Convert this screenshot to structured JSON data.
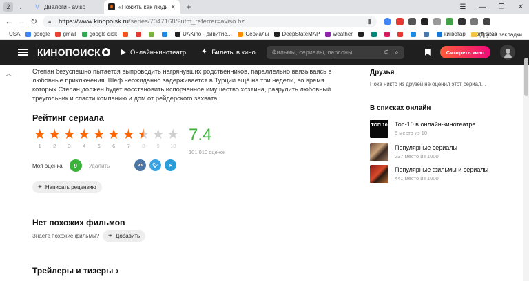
{
  "browser": {
    "tab_counter": "2",
    "tabs": [
      {
        "label": "Диалоги - aviso",
        "favicon_color": "#7aa7ff"
      },
      {
        "label": "«Пожить как люди» (2…",
        "favicon_color": "#f60"
      }
    ],
    "url_host": "https://www.kinopoisk.ru",
    "url_path": "/series/7047168/?utm_referrer=aviso.bz",
    "bookmarks": [
      {
        "label": "USA",
        "color": "#ffffff"
      },
      {
        "label": "google",
        "color": "#4285f4"
      },
      {
        "label": "gmail",
        "color": "#ea4335"
      },
      {
        "label": "google disk",
        "color": "#34a853"
      },
      {
        "label": "",
        "color": "#f4511e"
      },
      {
        "label": "",
        "color": "#e53935"
      },
      {
        "label": "",
        "color": "#7cb342"
      },
      {
        "label": "",
        "color": "#1e88e5"
      },
      {
        "label": "UAKino - дивитис…",
        "color": "#222222"
      },
      {
        "label": "Сериалы",
        "color": "#fb8c00"
      },
      {
        "label": "DeepStateMAP",
        "color": "#222222"
      },
      {
        "label": "weather",
        "color": "#8e24aa"
      },
      {
        "label": "",
        "color": "#222222"
      },
      {
        "label": "",
        "color": "#00897b"
      },
      {
        "label": "",
        "color": "#d81b60"
      },
      {
        "label": "",
        "color": "#e53935"
      },
      {
        "label": "",
        "color": "#1e88e5"
      },
      {
        "label": "",
        "color": "#4a76a8"
      },
      {
        "label": "київстар",
        "color": "#1976d2"
      },
      {
        "label": "earn sites",
        "color": "#ffffff"
      }
    ],
    "bookmarks_more": "Другие закладки"
  },
  "header": {
    "logo": "КИНОПОИСК",
    "nav_online": "Онлайн-кинотеатр",
    "nav_tickets": "Билеты в кино",
    "search_placeholder": "Фильмы, сериалы, персоны",
    "watch_button": "Смотреть кино"
  },
  "synopsis": "Степан безуспешно пытается выпроводить нагрянувших родственников, параллельно ввязываясь в любовные приключения. Шеф неожиданно задерживается в Турции ещё на три недели, во время которых Степан должен будет восстановить испорченное имущество хозяина, разрулить любовный треугольник и спасти компанию и дом от рейдерского захвата.",
  "rating": {
    "title": "Рейтинг сериала",
    "score": "7.4",
    "score_value": 7.4,
    "votes": "101 010 оценок",
    "star_numbers": [
      "1",
      "2",
      "3",
      "4",
      "5",
      "6",
      "7",
      "8",
      "9",
      "10"
    ],
    "my_label": "Моя оценка",
    "my_score": "9",
    "delete_label": "Удалить",
    "share": [
      "vk",
      "tw",
      "tg"
    ],
    "review_button": "Написать рецензию"
  },
  "similar": {
    "title": "Нет похожих фильмов",
    "question": "Знаете похожие фильмы?",
    "add_button": "Добавить"
  },
  "trailers_title": "Трейлеры и тизеры",
  "sidebar": {
    "friends_title": "Друзья",
    "friends_empty": "Пока никто из друзей не оценил этот сериал…",
    "lists_title": "В списках онлайн",
    "lists": [
      {
        "title": "Топ-10 в онлайн-кинотеатре",
        "sub": "5 место из 10",
        "thumb_text": "ТОП 10"
      },
      {
        "title": "Популярные сериалы",
        "sub": "237 место из 1000",
        "thumb_text": ""
      },
      {
        "title": "Популярные фильмы и сериалы",
        "sub": "441 место из 1000",
        "thumb_text": ""
      }
    ]
  },
  "colors": {
    "accent_orange": "#ff6600",
    "rating_green": "#3bb33b",
    "header_bg": "#1f1f1f"
  }
}
